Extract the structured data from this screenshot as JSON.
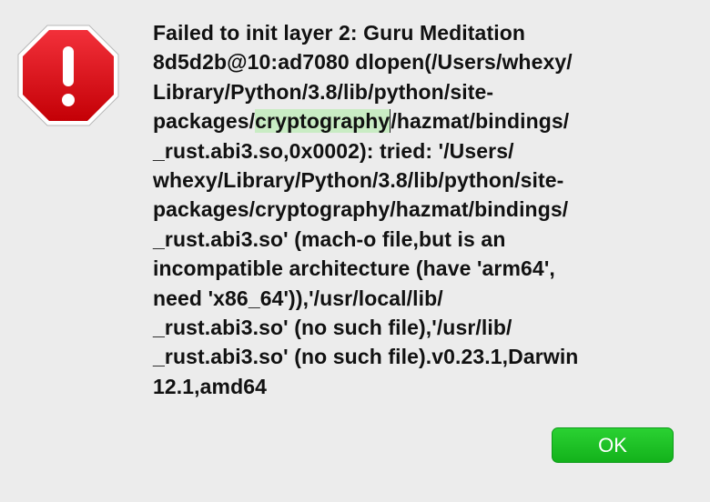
{
  "dialog": {
    "icon": "stop-octagon-exclamation-icon",
    "message_lines": [
      "Failed to init layer 2: Guru Meditation",
      "8d5d2b@10:ad7080 dlopen(/Users/whexy/",
      "Library/Python/3.8/lib/python/site-",
      "packages/",
      "cryptography",
      "/hazmat/bindings/",
      "_rust.abi3.so,0x0002): tried: '/Users/",
      "whexy/Library/Python/3.8/lib/python/site-",
      "packages/cryptography/hazmat/bindings/",
      "_rust.abi3.so' (mach-o file,but is an",
      "incompatible architecture (have 'arm64',",
      "need 'x86_64')),'/usr/local/lib/",
      "_rust.abi3.so' (no such file),'/usr/lib/",
      "_rust.abi3.so' (no such file).v0.23.1,Darwin",
      "12.1,amd64"
    ],
    "ok_label": "OK"
  },
  "colors": {
    "background": "#ececec",
    "icon_red": "#e00f12",
    "highlight": "#c9ecc4",
    "ok_button": "#1cc024"
  }
}
